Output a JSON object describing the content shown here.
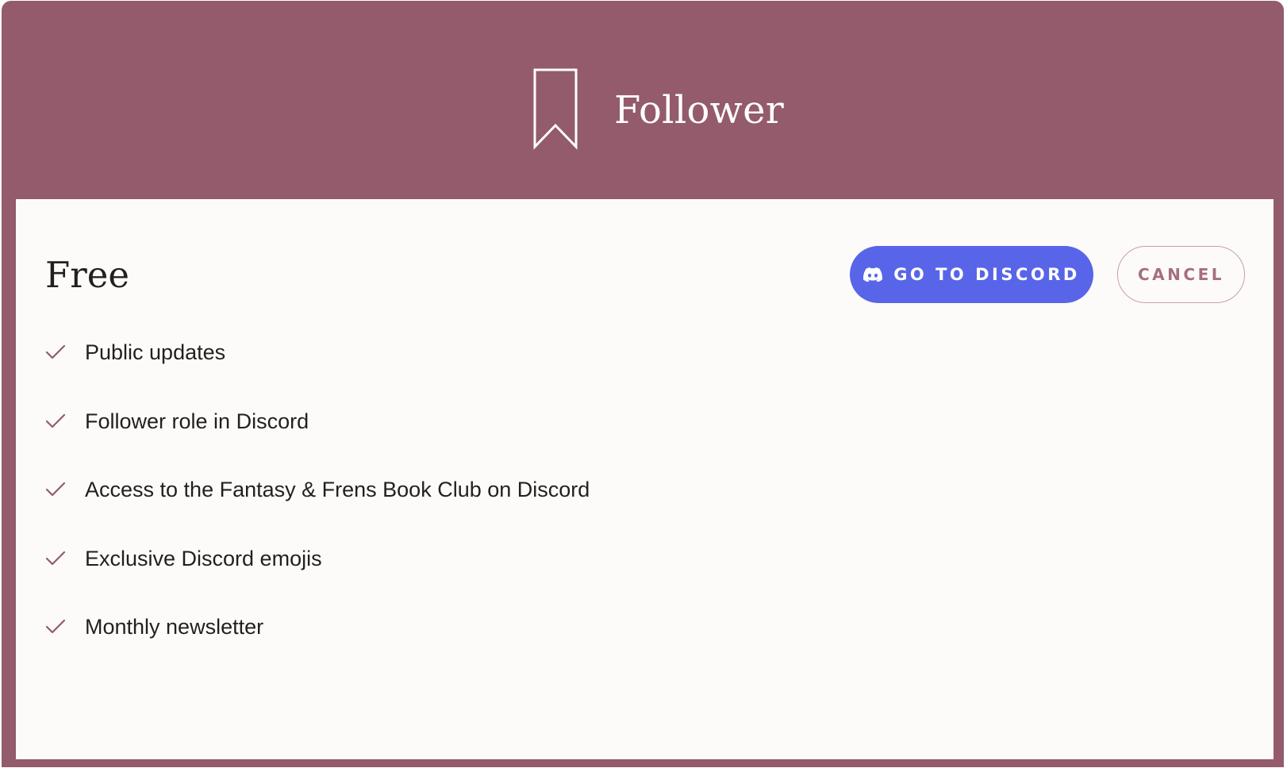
{
  "colors": {
    "brand_background": "#935b6b",
    "panel_background": "#fdfbf9",
    "discord_button": "#5865e8",
    "cancel_text": "#a56f7e",
    "check_color": "#935b6b"
  },
  "header": {
    "icon": "bookmark-icon",
    "tier_name": "Follower"
  },
  "panel": {
    "price": "Free",
    "discord_button": {
      "icon": "discord-icon",
      "label": "GO TO DISCORD"
    },
    "cancel_button": {
      "label": "CANCEL"
    },
    "benefits": [
      {
        "icon": "check-icon",
        "label": "Public updates"
      },
      {
        "icon": "check-icon",
        "label": "Follower role in Discord"
      },
      {
        "icon": "check-icon",
        "label": "Access to the Fantasy & Frens Book Club on Discord"
      },
      {
        "icon": "check-icon",
        "label": "Exclusive Discord emojis"
      },
      {
        "icon": "check-icon",
        "label": "Monthly newsletter"
      }
    ]
  }
}
